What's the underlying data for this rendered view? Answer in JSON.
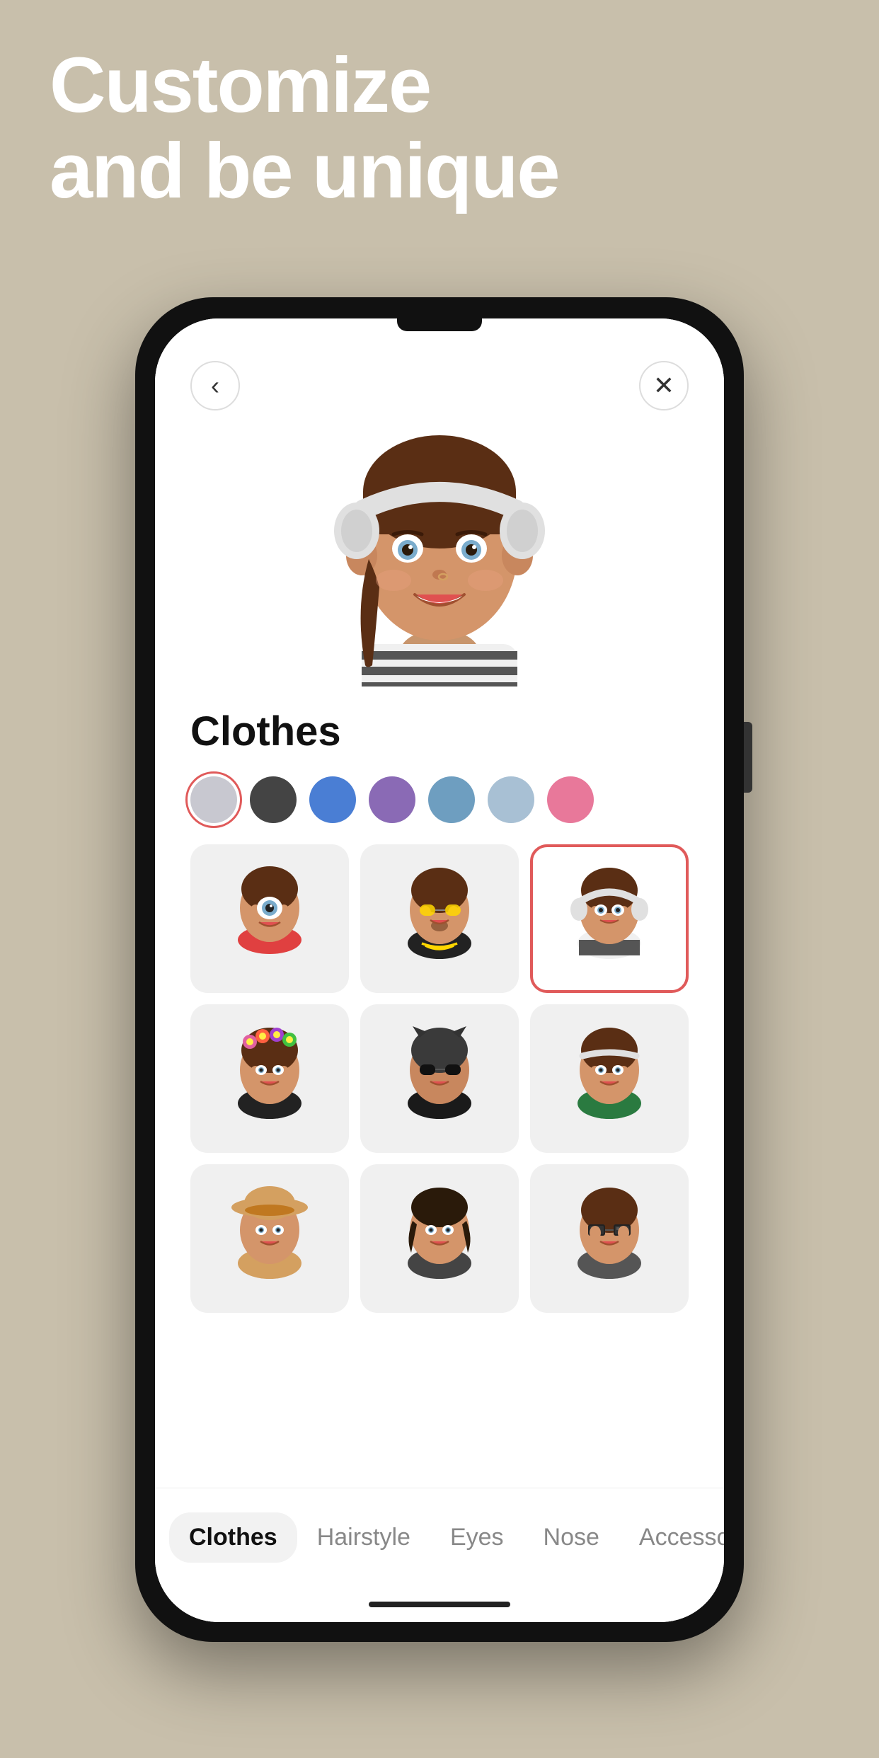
{
  "headline": {
    "line1": "Customize",
    "line2": "and be unique"
  },
  "phone": {
    "back_button": "‹",
    "close_button": "✕"
  },
  "clothes_section": {
    "title": "Clothes",
    "colors": [
      {
        "id": "light-gray",
        "hex": "#c8c8d0",
        "selected": true
      },
      {
        "id": "dark-gray",
        "hex": "#444444",
        "selected": false
      },
      {
        "id": "blue",
        "hex": "#4a7ed4",
        "selected": false
      },
      {
        "id": "purple",
        "hex": "#8a6ab5",
        "selected": false
      },
      {
        "id": "steel-blue",
        "hex": "#6e9ec0",
        "selected": false
      },
      {
        "id": "light-blue",
        "hex": "#a8c0d4",
        "selected": false
      },
      {
        "id": "pink",
        "hex": "#e8789a",
        "selected": false
      }
    ],
    "outfits": [
      {
        "id": 1,
        "selected": false,
        "label": "red-dress"
      },
      {
        "id": 2,
        "selected": false,
        "label": "black-jacket"
      },
      {
        "id": 3,
        "selected": true,
        "label": "striped-shirt"
      },
      {
        "id": 4,
        "selected": false,
        "label": "flower-crown"
      },
      {
        "id": 5,
        "selected": false,
        "label": "cat-ears"
      },
      {
        "id": 6,
        "selected": false,
        "label": "sporty-green"
      },
      {
        "id": 7,
        "selected": false,
        "label": "sun-hat"
      },
      {
        "id": 8,
        "selected": false,
        "label": "casual-dark"
      },
      {
        "id": 9,
        "selected": false,
        "label": "cool-glasses"
      }
    ]
  },
  "tabs": [
    {
      "id": "clothes",
      "label": "Clothes",
      "active": true
    },
    {
      "id": "hairstyle",
      "label": "Hairstyle",
      "active": false
    },
    {
      "id": "eyes",
      "label": "Eyes",
      "active": false
    },
    {
      "id": "nose",
      "label": "Nose",
      "active": false
    },
    {
      "id": "accessories",
      "label": "Accessories",
      "active": false
    }
  ]
}
